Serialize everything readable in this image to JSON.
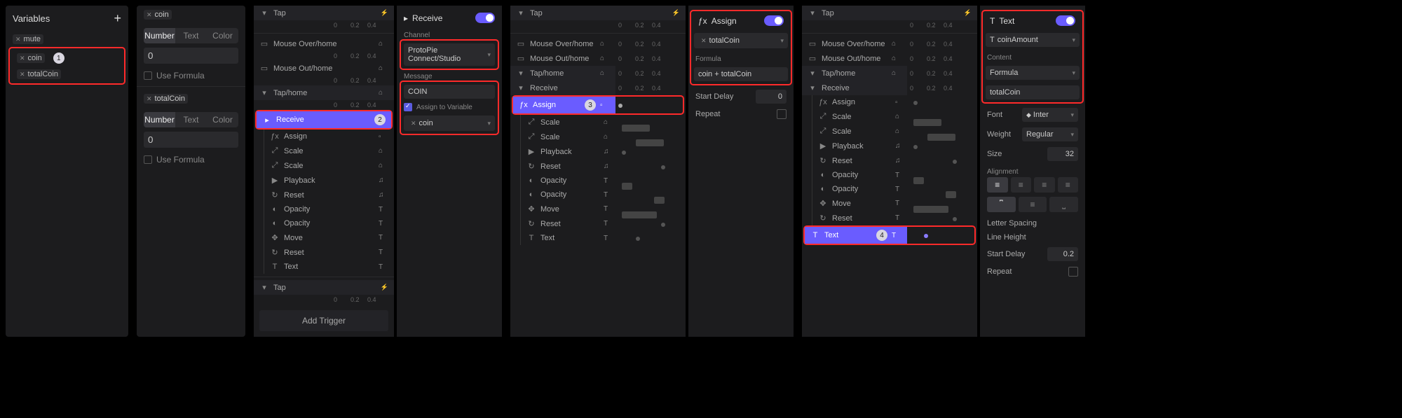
{
  "panel1": {
    "title": "Variables",
    "items": [
      "mute",
      "coin",
      "totalCoin"
    ],
    "badge": "1"
  },
  "panel2": {
    "section1": {
      "title": "coin",
      "tabs": [
        "Number",
        "Text",
        "Color"
      ],
      "value": "0",
      "useFormula": "Use Formula"
    },
    "section2": {
      "title": "totalCoin",
      "tabs": [
        "Number",
        "Text",
        "Color"
      ],
      "value": "0",
      "useFormula": "Use Formula"
    }
  },
  "ruler": [
    "0",
    "0.2",
    "0.4"
  ],
  "triggers": {
    "tap": "Tap",
    "mouseOverHome": "Mouse Over/home",
    "mouseOutHome": "Mouse Out/home",
    "tapHome": "Tap/home",
    "receive": "Receive",
    "assign": "Assign",
    "scale": "Scale",
    "playback": "Playback",
    "reset": "Reset",
    "opacity": "Opacity",
    "move": "Move",
    "text": "Text",
    "addTrigger": "Add Trigger"
  },
  "badge2": "2",
  "badge3": "3",
  "badge4": "4",
  "inspector2": {
    "title": "Receive",
    "channelLabel": "Channel",
    "channelValue": "ProtoPie Connect/Studio",
    "messageLabel": "Message",
    "messageValue": "COIN",
    "assignChk": "Assign to Variable",
    "varValue": "coin"
  },
  "inspector3": {
    "title": "Assign",
    "target": "totalCoin",
    "formulaLabel": "Formula",
    "formulaValue": "coin + totalCoin",
    "startDelayLabel": "Start Delay",
    "startDelayValue": "0",
    "repeatLabel": "Repeat"
  },
  "inspector4": {
    "title": "Text",
    "target": "coinAmount",
    "contentLabel": "Content",
    "contentType": "Formula",
    "contentValue": "totalCoin",
    "fontLabel": "Font",
    "fontValue": "Inter",
    "weightLabel": "Weight",
    "weightValue": "Regular",
    "sizeLabel": "Size",
    "sizeValue": "32",
    "alignLabel": "Alignment",
    "letterLabel": "Letter Spacing",
    "lineLabel": "Line Height",
    "startDelayLabel": "Start Delay",
    "startDelayValue": "0.2",
    "repeatLabel": "Repeat"
  }
}
